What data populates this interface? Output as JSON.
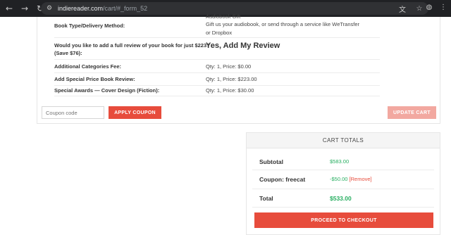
{
  "browser": {
    "url_host": "indiereader.com",
    "url_path": "/cart/#_form_52"
  },
  "options": [
    {
      "label": "Book Type/Delivery Method:",
      "value_top": "Audiobook Gift",
      "value": "Gift us your audiobook, or send through a service like WeTransfer",
      "value2": "or Dropbox"
    },
    {
      "label": "Would you like to add a full review of your book for just $223?",
      "label2": "(Save $76):",
      "value": "Yes, Add My Review"
    },
    {
      "label": "Additional Categories Fee:",
      "value": "Qty: 1, Price: $0.00"
    },
    {
      "label": "Add Special Price Book Review:",
      "value": "Qty: 1, Price: $223.00"
    },
    {
      "label": "Special Awards — Cover Design (Fiction):",
      "value": "Qty: 1, Price: $30.00"
    }
  ],
  "coupon": {
    "placeholder": "Coupon code",
    "apply_label": "APPLY COUPON",
    "update_label": "UPDATE CART"
  },
  "totals": {
    "heading": "CART TOTALS",
    "subtotal_label": "Subtotal",
    "subtotal_value": "$583.00",
    "coupon_label": "Coupon: freecat",
    "coupon_value": "-$50.00",
    "coupon_remove": "[Remove]",
    "total_label": "Total",
    "total_value": "$533.00",
    "checkout_label": "PROCEED TO CHECKOUT"
  },
  "colors": {
    "accent": "#e74c3c",
    "accent_disabled": "#f2a8a0",
    "price_green": "#27ae60"
  }
}
